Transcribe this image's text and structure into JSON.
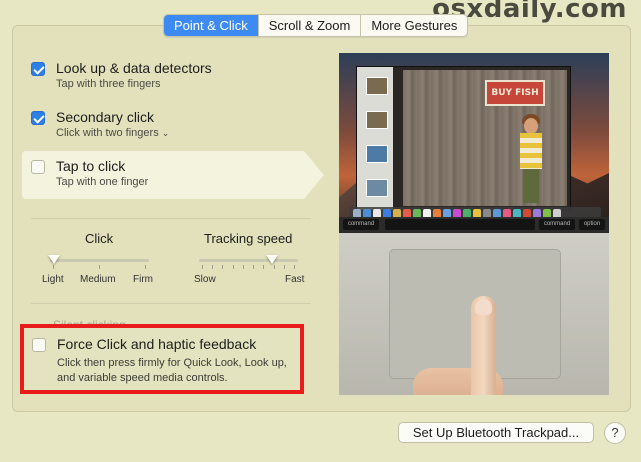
{
  "watermark": "osxdaily.com",
  "tabs": [
    {
      "label": "Point & Click",
      "active": true
    },
    {
      "label": "Scroll & Zoom",
      "active": false
    },
    {
      "label": "More Gestures",
      "active": false
    }
  ],
  "options": {
    "lookup": {
      "title": "Look up & data detectors",
      "sub": "Tap with three fingers",
      "checked": true
    },
    "secondary": {
      "title": "Secondary click",
      "sub": "Click with two fingers",
      "checked": true
    },
    "tap": {
      "title": "Tap to click",
      "sub": "Tap with one finger",
      "checked": false
    },
    "force": {
      "title": "Force Click and haptic feedback",
      "sub_line1": "Click then press firmly for Quick Look, Look up,",
      "sub_line2": "and variable speed media controls.",
      "checked": false
    }
  },
  "ghost_label": "Silent clicking",
  "click_slider": {
    "label": "Click",
    "ticks": [
      "Light",
      "Medium",
      "Firm"
    ],
    "value": "Light"
  },
  "tracking_slider": {
    "label": "Tracking speed",
    "ticks": [
      "Slow",
      "Fast"
    ],
    "value_fraction": 0.75
  },
  "preview": {
    "banner_text": "BUY FISH",
    "keys": {
      "left1": "command",
      "right1": "command",
      "right2": "option"
    }
  },
  "buttons": {
    "bluetooth": "Set Up Bluetooth Trackpad...",
    "help": "?"
  },
  "colors": {
    "accent": "#3d8bf2",
    "highlight_border": "#e91b1b",
    "background": "#e8e7c4"
  }
}
